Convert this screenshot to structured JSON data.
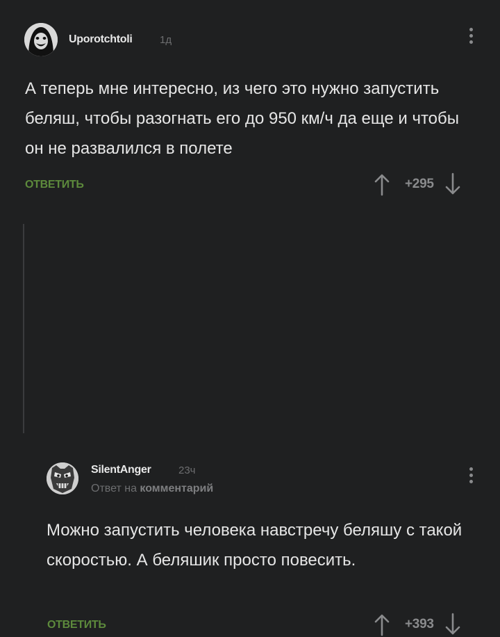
{
  "comments": [
    {
      "username": "Uporotchtoli",
      "time": "1д",
      "text": "А теперь мне интересно, из чего это нужно запустить беляш, чтобы разогнать его до 950 км/ч да еще и чтобы он не развалился в полете",
      "reply_label": "ОТВЕТИТЬ",
      "rating": "+295",
      "avatar_icon": "hooded-face-avatar"
    },
    {
      "username": "SilentAnger",
      "time": "23ч",
      "reply_to_prefix": "Ответ на",
      "reply_to_link": "комментарий",
      "text": "Можно запустить человека навстречу беляшу с такой скоростью. А беляшик просто повесить.",
      "reply_label": "ОТВЕТИТЬ",
      "rating": "+393",
      "avatar_icon": "masked-face-avatar"
    }
  ],
  "colors": {
    "background": "#1f2021",
    "accent_green": "#5d8a3c",
    "muted": "#6d6e70",
    "text": "#e6e6e6"
  }
}
